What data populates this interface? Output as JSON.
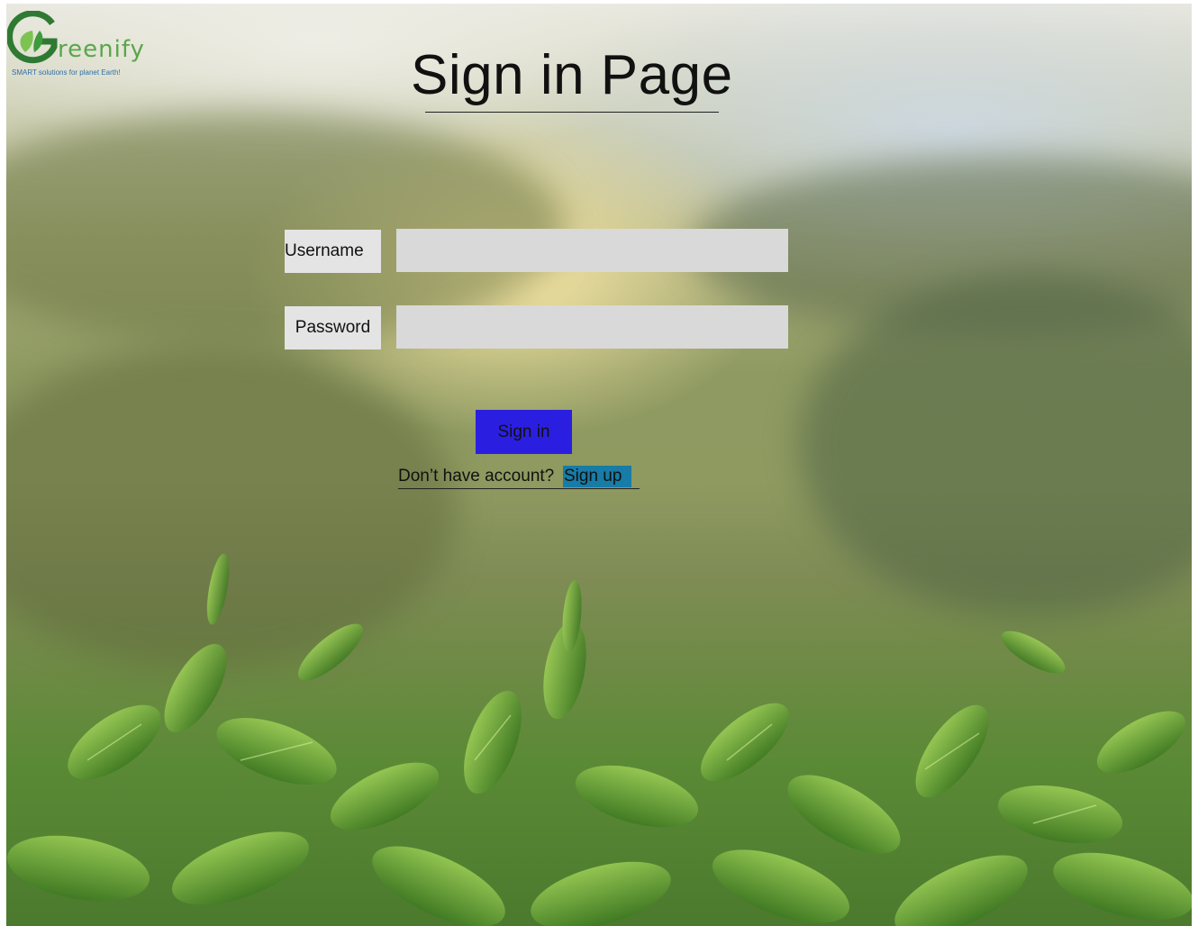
{
  "logo": {
    "word": "reenify",
    "tagline": "SMART solutions for planet Earth!"
  },
  "page": {
    "title": "Sign in Page"
  },
  "form": {
    "username_label": "Username",
    "username_value": "",
    "password_label": "Password",
    "password_value": "",
    "signin_label": "Sign in"
  },
  "signup": {
    "prompt": "Don’t have account?",
    "link_label": "Sign up"
  },
  "colors": {
    "signin_button": "#2a1fe0",
    "signup_link_bg": "#177ca6",
    "input_bg": "#d9d9d9",
    "brand_green": "#5aa64a"
  }
}
